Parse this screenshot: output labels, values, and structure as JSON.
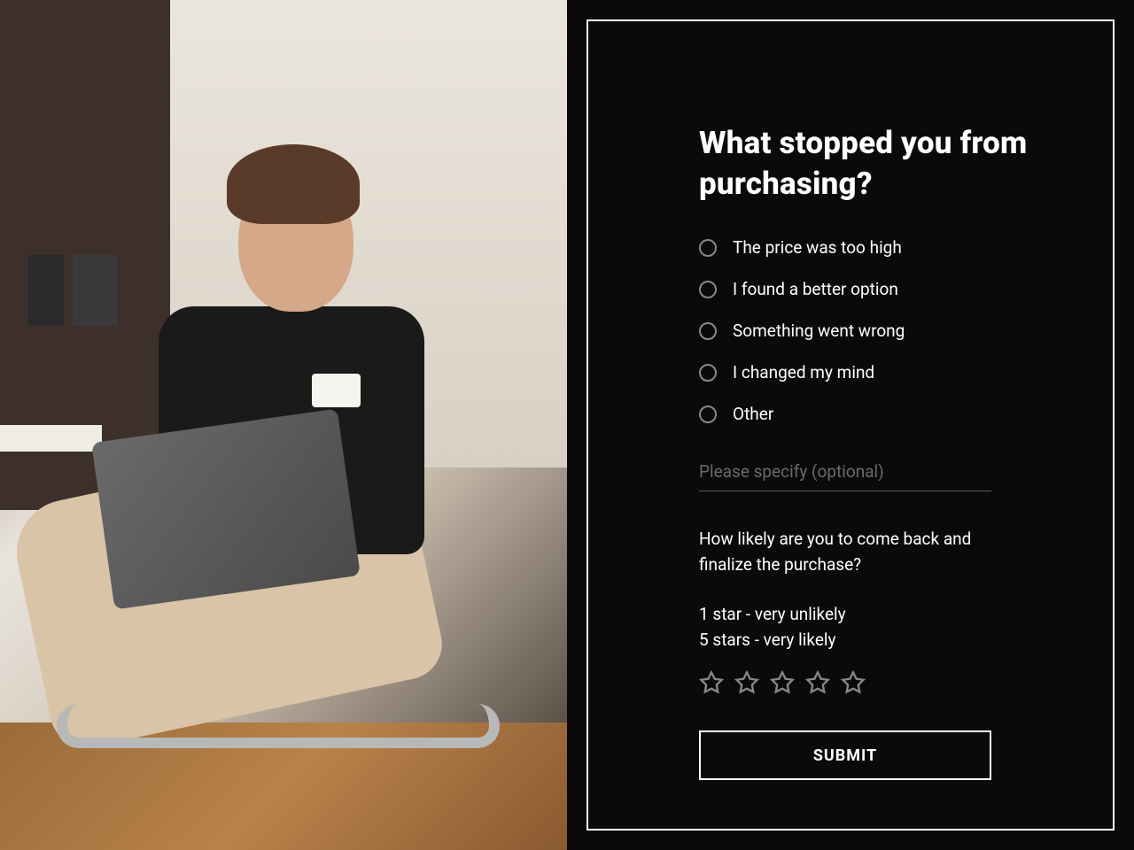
{
  "heading": "What stopped you from purchasing?",
  "options": [
    {
      "label": "The price was too high"
    },
    {
      "label": "I found a better option"
    },
    {
      "label": "Something went wrong"
    },
    {
      "label": "I changed my mind"
    },
    {
      "label": "Other"
    }
  ],
  "specify_placeholder": "Please specify (optional)",
  "likelihood_question": "How likely are you to come back and finalize the purchase?",
  "scale_hint_low": "1 star - very unlikely",
  "scale_hint_high": "5 stars - very likely",
  "submit_label": "SUBMIT"
}
